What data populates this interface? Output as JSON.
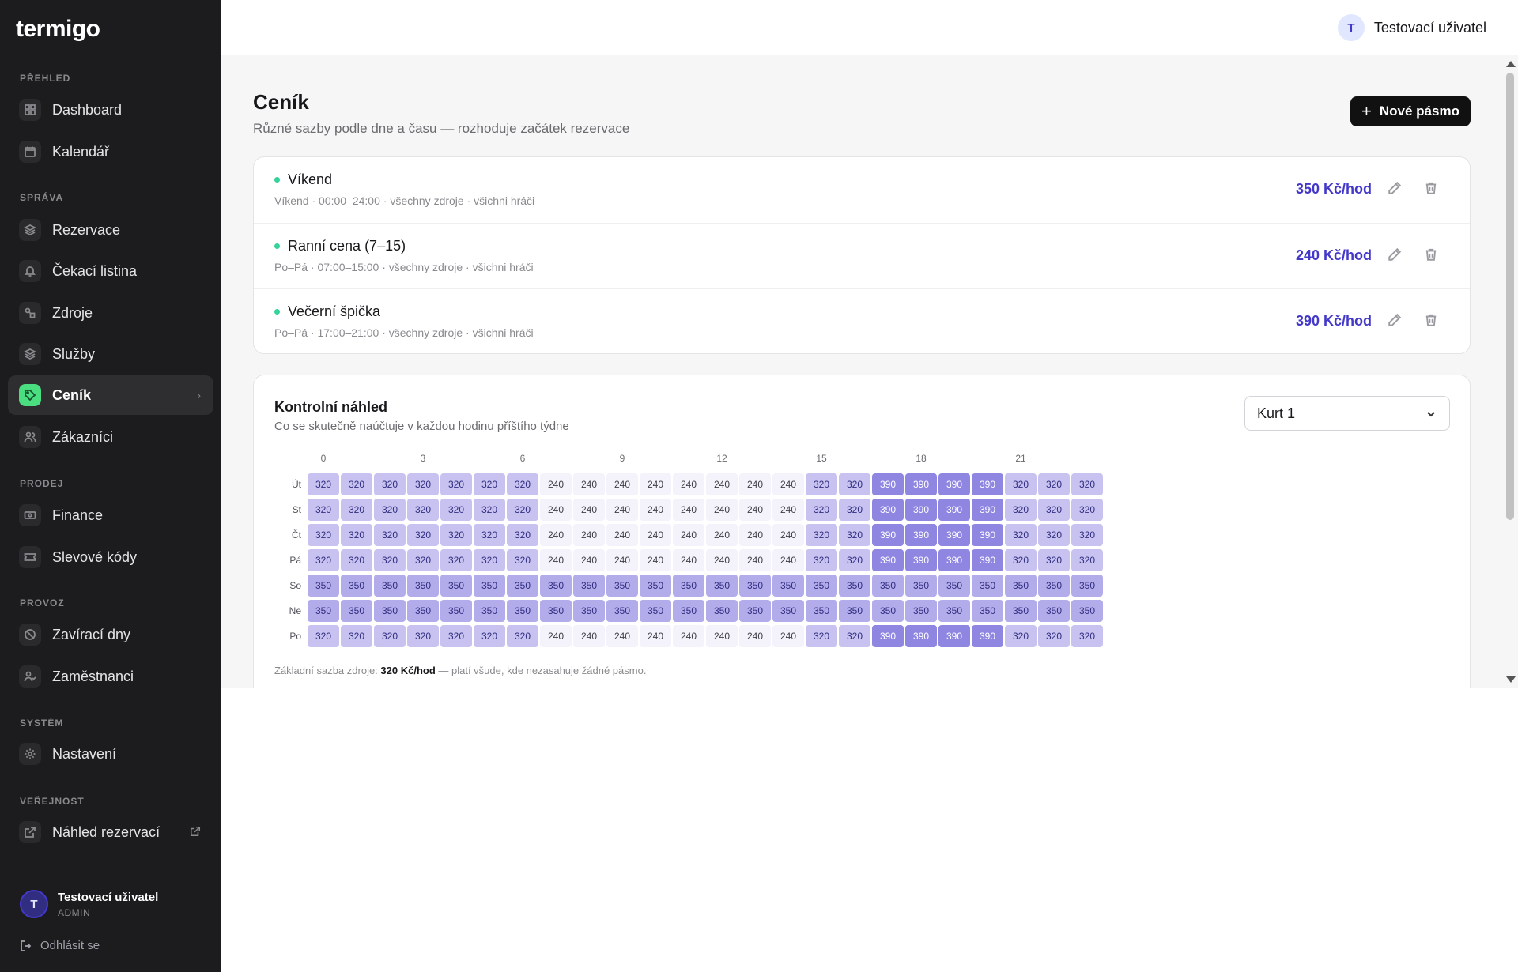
{
  "sidebar": {
    "logo": "termigo",
    "sections": {
      "prehled": "PŘEHLED",
      "sprava": "SPRÁVA",
      "prodej": "PRODEJ",
      "provoz": "PROVOZ",
      "system": "SYSTÉM",
      "verejnost": "VEŘEJNOST"
    },
    "items": {
      "dashboard": "Dashboard",
      "kalendar": "Kalendář",
      "rezervace": "Rezervace",
      "cekaci": "Čekací listina",
      "zdroje": "Zdroje",
      "sluzby": "Služby",
      "cenik": "Ceník",
      "zakaznici": "Zákazníci",
      "finance": "Finance",
      "slevove": "Slevové kódy",
      "zaviraci": "Zavírací dny",
      "zamestnanci": "Zaměstnanci",
      "nastaveni": "Nastavení",
      "nahled": "Náhled rezervací"
    },
    "active_item": "Ceník",
    "user": {
      "initial": "T",
      "name": "Testovací uživatel",
      "role": "ADMIN"
    },
    "logout": "Odhlásit se"
  },
  "topbar": {
    "user_initial": "T",
    "user_name": "Testovací uživatel"
  },
  "page": {
    "title": "Ceník",
    "subtitle": "Různé sazby podle dne a času — rozhoduje začátek rezervace",
    "new_button": "Nové pásmo"
  },
  "bands": [
    {
      "name": "Víkend",
      "meta": "Víkend · 00:00–24:00 · všechny zdroje · všichni hráči",
      "price": "350 Kč/hod"
    },
    {
      "name": "Ranní cena (7–15)",
      "meta": "Po–Pá · 07:00–15:00 · všechny zdroje · všichni hráči",
      "price": "240 Kč/hod"
    },
    {
      "name": "Večerní špička",
      "meta": "Po–Pá · 17:00–21:00 · všechny zdroje · všichni hráči",
      "price": "390 Kč/hod"
    }
  ],
  "preview": {
    "title": "Kontrolní náhled",
    "subtitle": "Co se skutečně naúčtuje v každou hodinu příštího týdne",
    "resource_select": "Kurt 1",
    "note_prefix": "Základní sazba zdroje: ",
    "note_rate": "320 Kč/hod",
    "note_suffix": " — platí všude, kde nezasahuje žádné pásmo."
  },
  "colors": {
    "accent": "#4338ca",
    "active_nav": "#4ade80",
    "band_dot": "#34d399",
    "cell_240": "#f4f2fb",
    "cell_320": "#c7c2f0",
    "cell_350": "#b3aceb",
    "cell_390": "#8f86e2"
  },
  "chart_data": {
    "type": "heatmap",
    "x_ticks": [
      "0",
      "3",
      "6",
      "9",
      "12",
      "15",
      "18",
      "21"
    ],
    "x": [
      0,
      1,
      2,
      3,
      4,
      5,
      6,
      7,
      8,
      9,
      10,
      11,
      12,
      13,
      14,
      15,
      16,
      17,
      18,
      19,
      20,
      21,
      22,
      23
    ],
    "rows": [
      {
        "day": "Út",
        "values": [
          320,
          320,
          320,
          320,
          320,
          320,
          320,
          240,
          240,
          240,
          240,
          240,
          240,
          240,
          240,
          320,
          320,
          390,
          390,
          390,
          390,
          320,
          320,
          320
        ]
      },
      {
        "day": "St",
        "values": [
          320,
          320,
          320,
          320,
          320,
          320,
          320,
          240,
          240,
          240,
          240,
          240,
          240,
          240,
          240,
          320,
          320,
          390,
          390,
          390,
          390,
          320,
          320,
          320
        ]
      },
      {
        "day": "Čt",
        "values": [
          320,
          320,
          320,
          320,
          320,
          320,
          320,
          240,
          240,
          240,
          240,
          240,
          240,
          240,
          240,
          320,
          320,
          390,
          390,
          390,
          390,
          320,
          320,
          320
        ]
      },
      {
        "day": "Pá",
        "values": [
          320,
          320,
          320,
          320,
          320,
          320,
          320,
          240,
          240,
          240,
          240,
          240,
          240,
          240,
          240,
          320,
          320,
          390,
          390,
          390,
          390,
          320,
          320,
          320
        ]
      },
      {
        "day": "So",
        "values": [
          350,
          350,
          350,
          350,
          350,
          350,
          350,
          350,
          350,
          350,
          350,
          350,
          350,
          350,
          350,
          350,
          350,
          350,
          350,
          350,
          350,
          350,
          350,
          350
        ]
      },
      {
        "day": "Ne",
        "values": [
          350,
          350,
          350,
          350,
          350,
          350,
          350,
          350,
          350,
          350,
          350,
          350,
          350,
          350,
          350,
          350,
          350,
          350,
          350,
          350,
          350,
          350,
          350,
          350
        ]
      },
      {
        "day": "Po",
        "values": [
          320,
          320,
          320,
          320,
          320,
          320,
          320,
          240,
          240,
          240,
          240,
          240,
          240,
          240,
          240,
          320,
          320,
          390,
          390,
          390,
          390,
          320,
          320,
          320
        ]
      }
    ]
  }
}
